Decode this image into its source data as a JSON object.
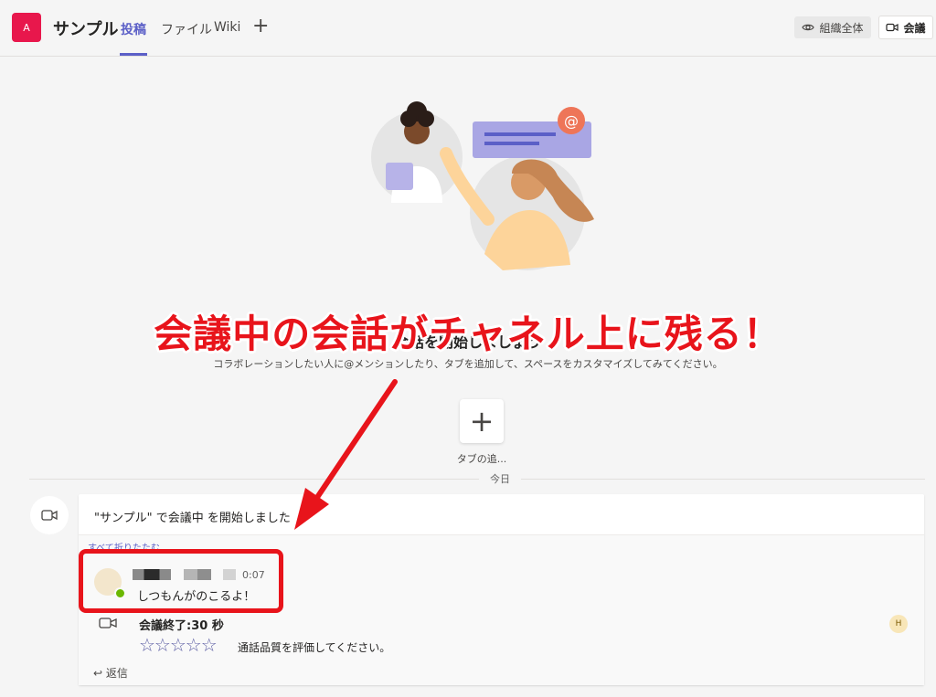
{
  "header": {
    "team_initial": "A",
    "team_name": "サンプル",
    "tabs": [
      {
        "label": "投稿",
        "active": true
      },
      {
        "label": "ファイル",
        "active": false
      },
      {
        "label": "Wiki",
        "active": false
      }
    ],
    "add_tab_glyph": "+",
    "org_button_label": "組織全体",
    "meet_button_label": "会議"
  },
  "welcome": {
    "title": "会話を開始しましょう",
    "subtitle": "コラボレーションしたい人に@メンションしたり、タブを追加して、スペースをカスタマイズしてみてください。",
    "add_tab_label": "タブの追..."
  },
  "divider": {
    "label": "今日"
  },
  "post": {
    "title": "\"サンプル\" で会議中 を開始しました",
    "collapse_label": "すべて折りたたむ",
    "reply": {
      "time": "0:07",
      "text": "しつもんがのこるよ！"
    },
    "meeting_ended": "会議終了:30 秒",
    "stars": "☆☆☆☆☆",
    "rating_prompt": "通話品質を評価してください。",
    "participant_initial": "H",
    "reply_label": "返信"
  },
  "annotation": {
    "text": "会議中の会話がチャネル上に残る！"
  },
  "colors": {
    "accent": "#5b5fc7",
    "team_avatar": "#e8174c",
    "annotation_red": "#e8141b",
    "presence_green": "#6bb700"
  }
}
